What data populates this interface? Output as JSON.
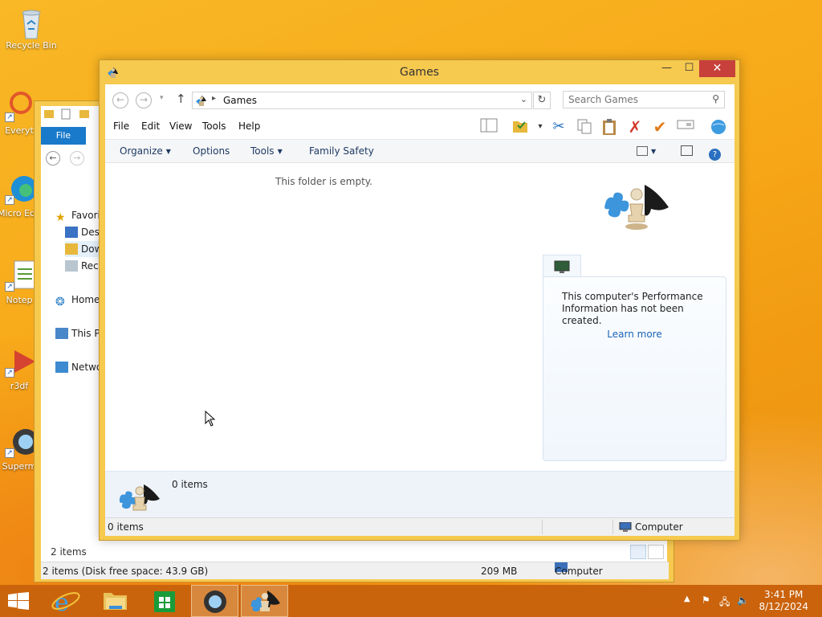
{
  "desktop": {
    "icons": [
      {
        "label": "Recycle Bin"
      },
      {
        "label": "Everyt"
      },
      {
        "label": "Micro Edg"
      },
      {
        "label": "Notep"
      },
      {
        "label": "r3df"
      },
      {
        "label": "Superm"
      }
    ]
  },
  "back_window": {
    "file_tab": "File",
    "tree": [
      {
        "label": "Favori"
      },
      {
        "label": "Desk"
      },
      {
        "label": "Dow"
      },
      {
        "label": "Rece"
      },
      {
        "label": "Home"
      },
      {
        "label": "This P"
      },
      {
        "label": "Netwo"
      }
    ],
    "status_items": "2 items",
    "status_disk": "2 items (Disk free space: 43.9 GB)",
    "status_size": "209 MB",
    "status_location": "Computer"
  },
  "window": {
    "title": "Games",
    "minimize_glyph": "—",
    "maximize_glyph": "☐",
    "close_glyph": "✕",
    "address": {
      "breadcrumb": "Games",
      "search_placeholder": "Search Games"
    },
    "menu": [
      "File",
      "Edit",
      "View",
      "Tools",
      "Help"
    ],
    "commands": {
      "organize": "Organize",
      "options": "Options",
      "tools": "Tools",
      "family_safety": "Family Safety"
    },
    "content": {
      "empty_message": "This folder is empty."
    },
    "performance": {
      "text": "This computer's Performance Information has not been created.",
      "link": "Learn more"
    },
    "details": {
      "count": "0 items"
    },
    "status": {
      "left": "0 items",
      "right": "Computer"
    }
  },
  "taskbar": {
    "clock_time": "3:41 PM",
    "clock_date": "8/12/2024"
  },
  "colors": {
    "desktop": "#f7a818",
    "window_frame": "#f6c94f",
    "close_button": "#c7403a",
    "taskbar": "#c7600c",
    "link": "#1a64b8"
  }
}
